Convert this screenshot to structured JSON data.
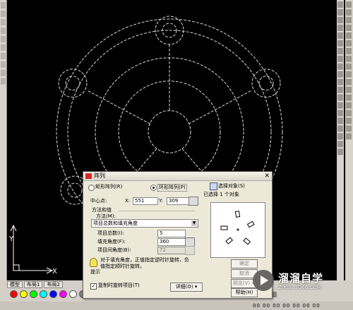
{
  "dialog": {
    "title": "阵列",
    "rect_array_label": "矩形阵列(R)",
    "polar_array_label": "环形阵列(P)",
    "select_objects_label": "选择对象(S)",
    "selected_count": "已选择 1 个对象",
    "center_label": "中心点:",
    "x_label": "X:",
    "x_value": "551",
    "y_label": "Y:",
    "y_value": "309",
    "method_group_label": "方法和值",
    "method_label": "方法(M):",
    "method_value": "项目总数和填充角度",
    "total_items_label": "项目总数(I):",
    "total_items_value": "5",
    "fill_angle_label": "填充角度(F):",
    "fill_angle_value": "360",
    "item_angle_label": "项目间角度(B):",
    "item_angle_value": "72",
    "tip_line1": "对于填充角度，正值指定逆时针旋转，负",
    "tip_line2": "值指定顺时针旋转。",
    "tip_label": "提示",
    "rotate_items_label": "复制时旋转项目(T)",
    "details_button": "详细(O) ▾",
    "ok_button": "确定",
    "cancel_button": "取消",
    "preview_button": "预览(V) <",
    "help_button": "帮助(H)"
  },
  "layout_tabs": [
    "模型",
    "布局1",
    "布局2"
  ],
  "palette_colors": [
    "#ff0000",
    "#ffff00",
    "#00ff00",
    "#00ffff",
    "#0000ff",
    "#ff00ff",
    "#ffffff",
    "#808080",
    "#c0c0c0"
  ],
  "status_numbers": "00 00 00 00 00 00 00",
  "watermark": {
    "brand": "溜溜自学",
    "url": "ZIXUE.3D66.COM"
  },
  "ucs": {
    "x_label": "X",
    "y_label": "Y"
  },
  "icons": [
    "close-icon",
    "select-objects-icon",
    "pick-center-icon",
    "pick-angle-icon",
    "tip-bulb-icon",
    "play-icon",
    "ucs-icon"
  ]
}
